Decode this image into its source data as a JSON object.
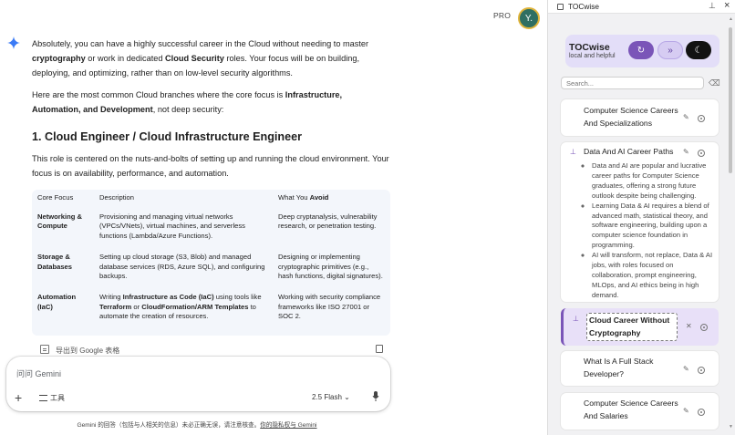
{
  "header": {
    "badge": "PRO",
    "avatar_initial": "Y."
  },
  "response": {
    "p1": [
      {
        "t": "Absolutely, you can have a highly successful career in the Cloud without needing to master "
      },
      {
        "t": "cryptography",
        "b": true
      },
      {
        "t": " or work in dedicated "
      },
      {
        "t": "Cloud Security",
        "b": true
      },
      {
        "t": " roles. Your focus will be on building, deploying, and optimizing, rather than on low-level security algorithms."
      }
    ],
    "p2": [
      {
        "t": "Here are the most common Cloud branches where the core focus is "
      },
      {
        "t": "Infrastructure, Automation, and Development",
        "b": true
      },
      {
        "t": ", not deep security:"
      }
    ],
    "heading": "1. Cloud Engineer / Cloud Infrastructure Engineer",
    "p3": "This role is centered on the nuts-and-bolts of setting up and running the cloud environment. Your focus is on availability, performance, and automation.",
    "table": {
      "headers": [
        "Core Focus",
        "Description",
        "What You ",
        "Avoid"
      ],
      "rows": [
        {
          "focus": "Networking & Compute",
          "desc": [
            {
              "t": "Provisioning and managing virtual networks (VPCs/VNets), virtual machines, and serverless functions (Lambda/Azure Functions)."
            }
          ],
          "avoid": "Deep cryptanalysis, vulnerability research, or penetration testing."
        },
        {
          "focus": "Storage & Databases",
          "desc": [
            {
              "t": "Setting up cloud storage (S3, Blob) and managed database services (RDS, Azure SQL), and configuring backups."
            }
          ],
          "avoid": "Designing or implementing cryptographic primitives (e.g., hash functions, digital signatures)."
        },
        {
          "focus": "Automation (IaC)",
          "desc": [
            {
              "t": "Writing "
            },
            {
              "t": "Infrastructure as Code (IaC)",
              "b": true
            },
            {
              "t": " using tools like "
            },
            {
              "t": "Terraform",
              "b": true
            },
            {
              "t": " or "
            },
            {
              "t": "CloudFormation/ARM Templates",
              "b": true
            },
            {
              "t": " to automate the creation of resources."
            }
          ],
          "avoid": "Working with security compliance frameworks like ISO 27001 or SOC 2."
        }
      ]
    },
    "export_label": "导出到 Google 表格"
  },
  "composer": {
    "placeholder": "问问 Gemini",
    "tools_label": "工具",
    "model_label": "2.5 Flash"
  },
  "disclaimer": {
    "text": "Gemini 的回答（包括与人相关的信息）未必正确无误，请注意核查。",
    "link": "你的隐私权与 Gemini"
  },
  "panel": {
    "title": "TOCwise",
    "brand_name": "TOCwise",
    "brand_tagline": "local and helpful",
    "search_placeholder": "Search...",
    "items": [
      {
        "title": "Computer Science Careers And Specializations",
        "pinned": false
      },
      {
        "title": "Data And AI Career Paths",
        "pinned": true,
        "bullets": [
          "Data and AI are popular and lucrative career paths for Computer Science graduates, offering a strong future outlook despite being challenging.",
          "Learning Data & AI requires a blend of advanced math, statistical theory, and software engineering, building upon a computer science foundation in programming.",
          "AI will transform, not replace, Data & AI jobs, with roles focused on collaboration, prompt engineering, MLOps, and AI ethics being in high demand."
        ]
      },
      {
        "title": "Cloud Career Without Cryptography",
        "pinned": true,
        "active": true
      },
      {
        "title": "What Is A Full Stack Developer?",
        "pinned": false
      },
      {
        "title": "Computer Science Careers And Salaries",
        "pinned": false
      }
    ]
  },
  "colors": {
    "accent": "#7a55b8",
    "brand_bg": "#e3def8",
    "gemini_star": "#3b7bf6"
  }
}
